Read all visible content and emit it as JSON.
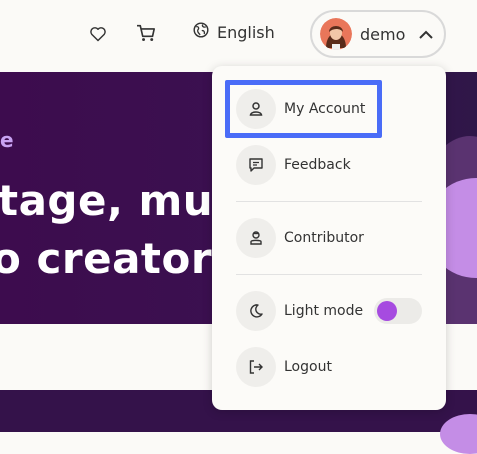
{
  "header": {
    "language": "English",
    "user": {
      "name": "demo"
    },
    "icons": {
      "wishlist": "heart-icon",
      "cart": "cart-icon",
      "globe": "globe-icon",
      "chevron": "chevron-up-icon"
    }
  },
  "hero": {
    "kicker": "e",
    "line1": "tage, mus",
    "line2": "o creators"
  },
  "menu": {
    "items": [
      {
        "label": "My Account",
        "icon": "user-icon"
      },
      {
        "label": "Feedback",
        "icon": "feedback-icon"
      },
      {
        "label": "Contributor",
        "icon": "contributor-icon"
      },
      {
        "label": "Light mode",
        "icon": "moon-icon"
      },
      {
        "label": "Logout",
        "icon": "logout-icon"
      }
    ],
    "light_mode_on": false
  },
  "colors": {
    "hero_bg": "#3d0c4e",
    "accent": "#a64be0",
    "highlight": "#4a6cf7"
  }
}
